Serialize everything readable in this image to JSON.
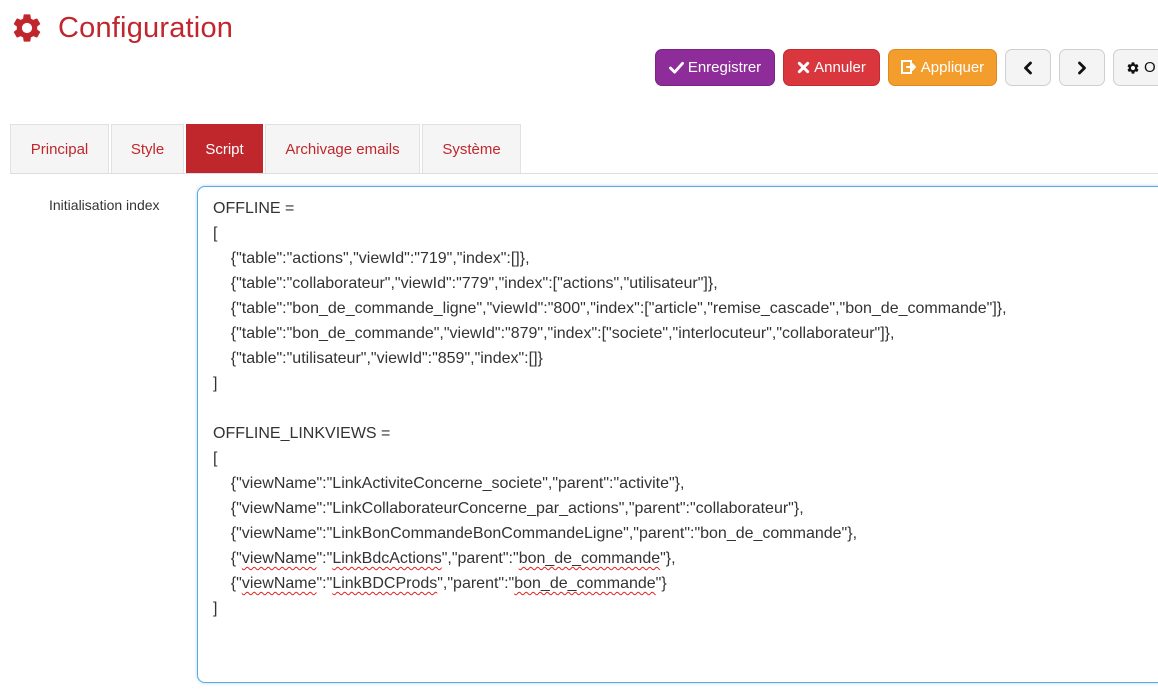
{
  "header": {
    "title": "Configuration",
    "icon": "gear-icon",
    "accent_color": "#c0272d"
  },
  "toolbar": {
    "save_label": "Enregistrer",
    "cancel_label": "Annuler",
    "apply_label": "Appliquer",
    "options_label": "O",
    "colors": {
      "save": "#8e2d9a",
      "cancel": "#d9363e",
      "apply": "#f29d2c"
    }
  },
  "tabs": [
    {
      "label": "Principal",
      "active": false
    },
    {
      "label": "Style",
      "active": false
    },
    {
      "label": "Script",
      "active": true
    },
    {
      "label": "Archivage emails",
      "active": false
    },
    {
      "label": "Système",
      "active": false
    }
  ],
  "field": {
    "label": "Initialisation index"
  },
  "script_lines": [
    "OFFLINE =",
    "[",
    "    {\"table\":\"actions\",\"viewId\":\"719\",\"index\":[]},",
    "    {\"table\":\"collaborateur\",\"viewId\":\"779\",\"index\":[\"actions\",\"utilisateur\"]},",
    "    {\"table\":\"bon_de_commande_ligne\",\"viewId\":\"800\",\"index\":[\"article\",\"remise_cascade\",\"bon_de_commande\"]},",
    "    {\"table\":\"bon_de_commande\",\"viewId\":\"879\",\"index\":[\"societe\",\"interlocuteur\",\"collaborateur\"]},",
    "    {\"table\":\"utilisateur\",\"viewId\":\"859\",\"index\":[]}",
    "]",
    "",
    "OFFLINE_LINKVIEWS =",
    "[",
    "    {\"viewName\":\"LinkActiviteConcerne_societe\",\"parent\":\"activite\"},",
    "    {\"viewName\":\"LinkCollaborateurConcerne_par_actions\",\"parent\":\"collaborateur\"},",
    "    {\"viewName\":\"LinkBonCommandeBonCommandeLigne\",\"parent\":\"bon_de_commande\"},",
    "    {\"viewName\":\"LinkBdcActions\",\"parent\":\"bon_de_commande\"},",
    "    {\"viewName\":\"LinkBDCProds\",\"parent\":\"bon_de_commande\"}",
    "]"
  ]
}
